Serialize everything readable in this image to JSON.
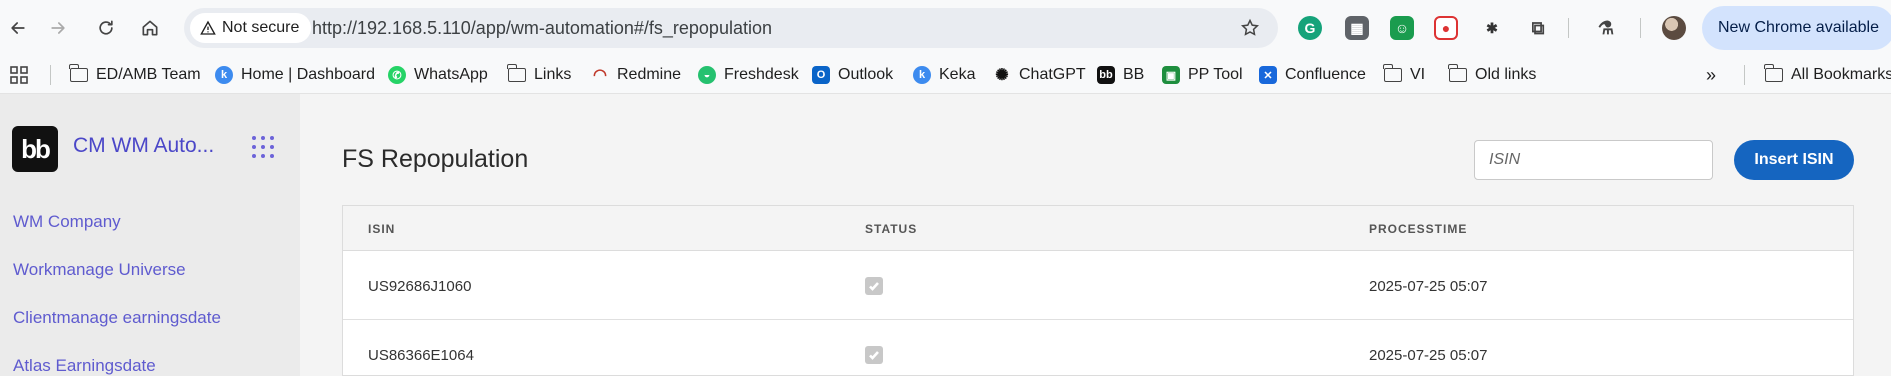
{
  "browser": {
    "security_label": "Not secure",
    "url": "http://192.168.5.110/app/wm-automation#/fs_repopulation",
    "new_chrome_label": "New Chrome available",
    "icons": [
      "back-icon",
      "forward-icon",
      "reload-icon",
      "home-icon",
      "star-icon",
      "grammarly-icon",
      "extension-icon",
      "puzzle-icon",
      "profile-avatar"
    ]
  },
  "bookmarks": [
    {
      "label": "ED/AMB Team",
      "icon": "folder"
    },
    {
      "label": "Home | Dashboard",
      "icon": "keka"
    },
    {
      "label": "WhatsApp",
      "icon": "whatsapp"
    },
    {
      "label": "Links",
      "icon": "folder"
    },
    {
      "label": "Redmine",
      "icon": "redmine"
    },
    {
      "label": "Freshdesk",
      "icon": "freshdesk"
    },
    {
      "label": "Outlook",
      "icon": "outlook"
    },
    {
      "label": "Keka",
      "icon": "keka"
    },
    {
      "label": "ChatGPT",
      "icon": "chatgpt"
    },
    {
      "label": "BB",
      "icon": "bb"
    },
    {
      "label": "PP Tool",
      "icon": "pptool"
    },
    {
      "label": "Confluence",
      "icon": "confluence"
    },
    {
      "label": "VI",
      "icon": "folder"
    },
    {
      "label": "Old links",
      "icon": "folder"
    }
  ],
  "all_bookmarks_label": "All Bookmarks",
  "app": {
    "logo_text": "bb",
    "title": "CM WM Auto...",
    "nav": [
      "WM Company",
      "Workmanage Universe",
      "Clientmanage earningsdate",
      "Atlas Earningsdate"
    ]
  },
  "page": {
    "title": "FS Repopulation",
    "isin_placeholder": "ISIN",
    "insert_button": "Insert ISIN"
  },
  "table": {
    "headers": [
      "ISIN",
      "STATUS",
      "PROCESSTIME"
    ],
    "rows": [
      {
        "isin": "US92686J1060",
        "status": true,
        "processtime": "2025-07-25 05:07"
      },
      {
        "isin": "US86366E1064",
        "status": true,
        "processtime": "2025-07-25 05:07"
      }
    ]
  }
}
